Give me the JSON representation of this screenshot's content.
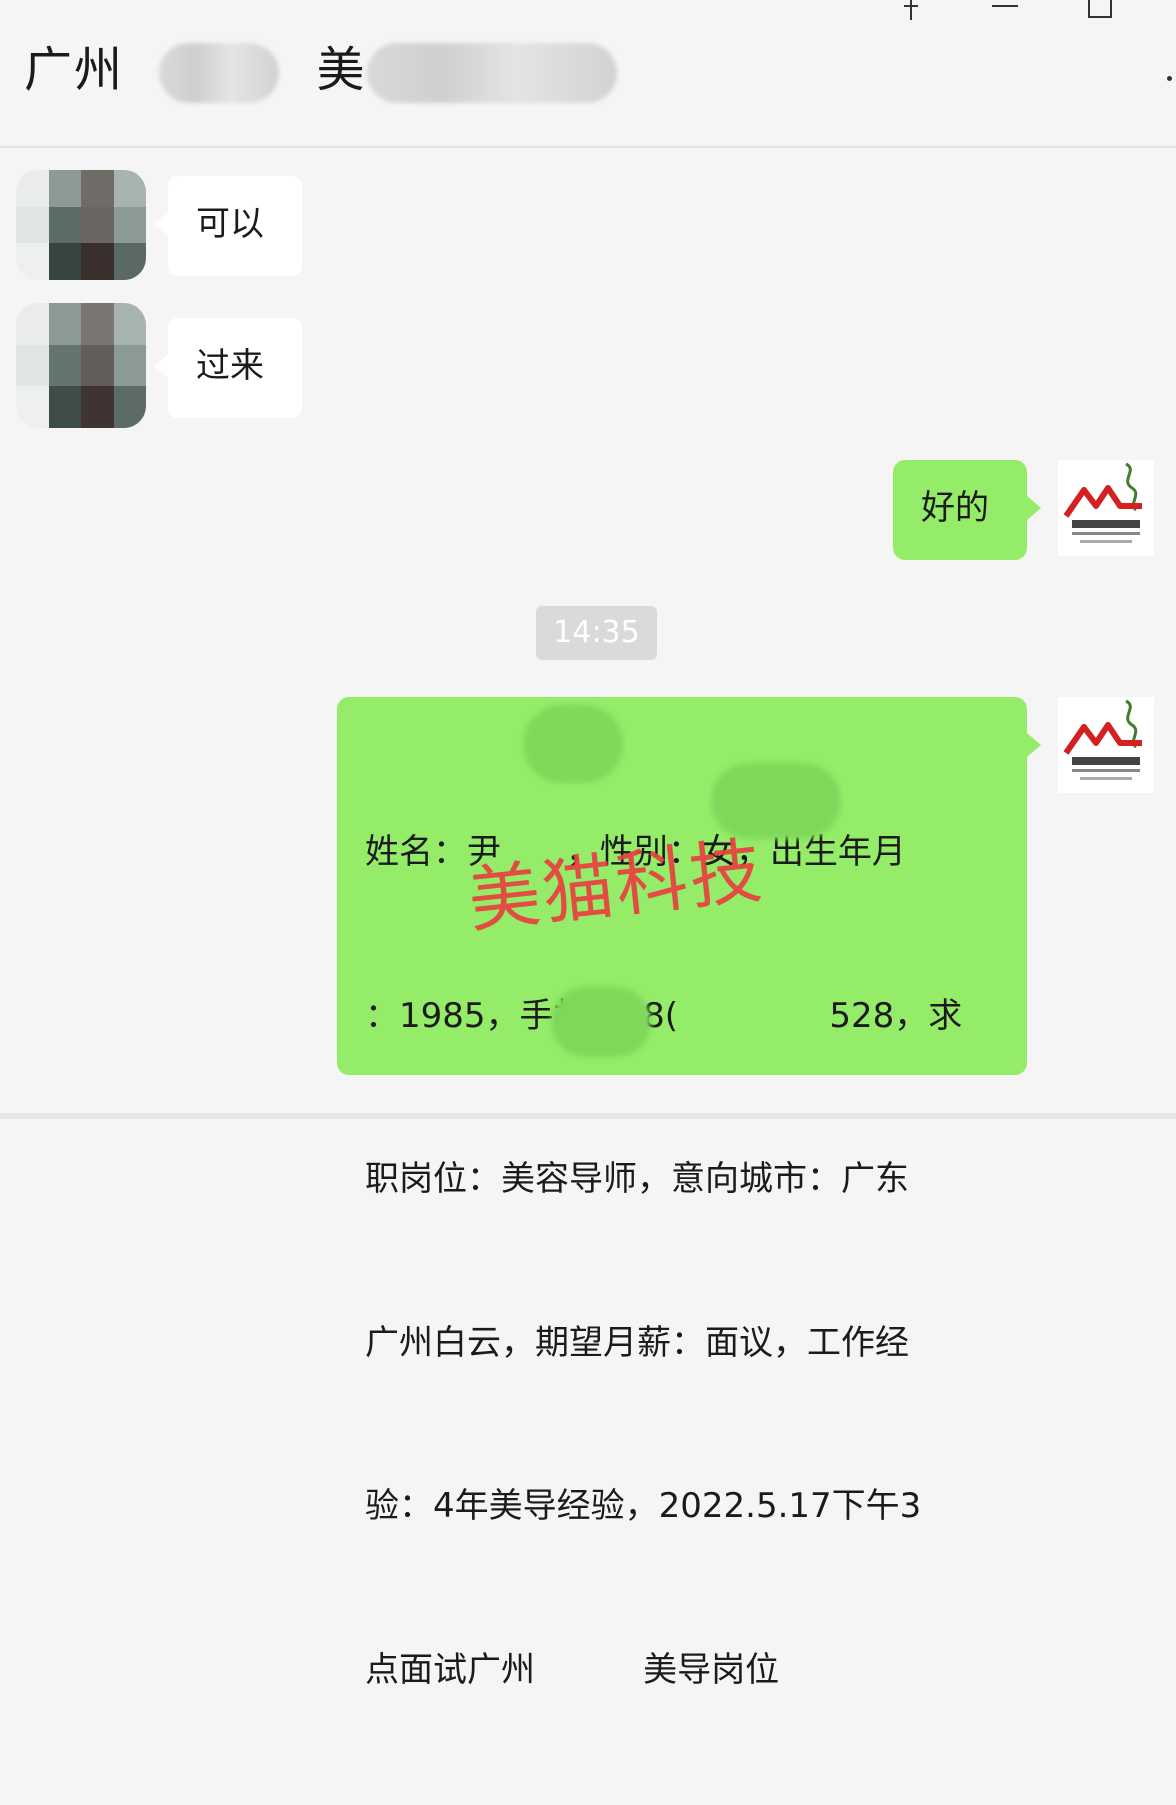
{
  "window": {
    "title_prefix": "广州",
    "title_middle": "美",
    "pin_icon": "pin-icon",
    "minimize_icon": "minimize-icon",
    "maximize_icon": "maximize-icon"
  },
  "messages": [
    {
      "side": "left",
      "text": "可以"
    },
    {
      "side": "left",
      "text": "过来"
    },
    {
      "side": "right",
      "text": "好的"
    },
    {
      "side": "right",
      "lines": [
        "姓名：尹      ，性别：女，出生年月",
        "：1985，手机：18(              528，求",
        "职岗位：美容导师，意向城市：广东",
        "广州白云，期望月薪：面议，工作经",
        "验：4年美导经验，2022.5.17下午3",
        "点面试广州          美导岗位"
      ]
    }
  ],
  "timestamp": "14:35",
  "watermark": "美猫科技",
  "colors": {
    "self_bubble": "#95ec69",
    "other_bubble": "#ffffff",
    "watermark": "#e94040",
    "background": "#f5f5f5"
  }
}
